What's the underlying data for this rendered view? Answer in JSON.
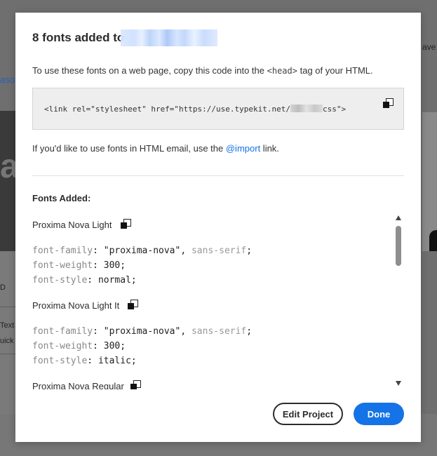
{
  "background": {
    "left_link": "ason",
    "left_word_1": "D",
    "left_word_2": "Text",
    "left_word_3": "uick",
    "right_text": "ave"
  },
  "modal": {
    "title": "8 fonts added to",
    "description": {
      "before": "To use these fonts on a web page, copy this code into the ",
      "tag": "<head>",
      "after": " tag of your HTML."
    },
    "code": {
      "prefix": "<link rel=\"stylesheet\" href=\"https://use.typekit.net/",
      "suffix": "css\">"
    },
    "email": {
      "before": "If you'd like to use fonts in HTML email, use the ",
      "link": "@import",
      "after": " link."
    },
    "fonts_added_label": "Fonts Added:",
    "fonts": [
      {
        "name": "Proxima Nova Light",
        "family_prop": "font-family",
        "family_value": "\"proxima-nova\"",
        "family_fallback": "sans-serif",
        "weight_prop": "font-weight",
        "weight_value": "300",
        "style_prop": "font-style",
        "style_value": "normal"
      },
      {
        "name": "Proxima Nova Light It",
        "family_prop": "font-family",
        "family_value": "\"proxima-nova\"",
        "family_fallback": "sans-serif",
        "weight_prop": "font-weight",
        "weight_value": "300",
        "style_prop": "font-style",
        "style_value": "italic"
      },
      {
        "name": "Proxima Nova Regular"
      }
    ],
    "buttons": {
      "edit_project": "Edit Project",
      "done": "Done"
    }
  },
  "colors": {
    "accent": "#1473e6",
    "overlay": "#6f6f6f",
    "code_bg": "#eeeeee"
  }
}
